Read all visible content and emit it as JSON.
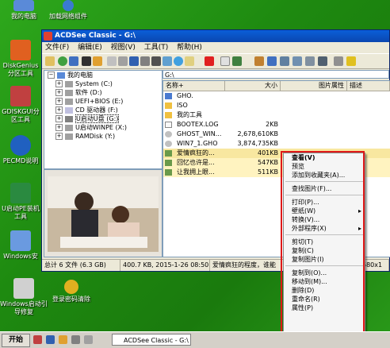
{
  "desktop": {
    "icons": [
      {
        "label": "我的电脑",
        "color": "#5a8ad8"
      },
      {
        "label": "加载网络组件",
        "color": "#3a7ad0"
      },
      {
        "label": "DiskGenius分区工具",
        "color": "#e06020"
      },
      {
        "label": "GDISKGUI分区工具",
        "color": "#c04040"
      },
      {
        "label": "PECMD说明",
        "color": "#2060c0"
      },
      {
        "label": "U启动PE装机工具",
        "color": "#2a8a40"
      },
      {
        "label": "Windows安",
        "color": "#6a9ae0"
      },
      {
        "label": "Windows启动引导修复",
        "color": "#d0d0d0"
      },
      {
        "label": "登录密码清除",
        "color": "#e0b020"
      }
    ]
  },
  "window": {
    "title": "ACDSee Classic - G:\\",
    "menus": [
      "文件(F)",
      "编辑(E)",
      "视图(V)",
      "工具(T)",
      "帮助(H)"
    ],
    "address": "G:\\",
    "tree": [
      {
        "label": "我的电脑",
        "depth": 0,
        "pm": "−"
      },
      {
        "label": "System (C:)",
        "depth": 1,
        "pm": "+"
      },
      {
        "label": "软件 (D:)",
        "depth": 1,
        "pm": "+"
      },
      {
        "label": "UEFI+BIOS (E:)",
        "depth": 1,
        "pm": "+"
      },
      {
        "label": "CD 驱动器 (F:)",
        "depth": 1,
        "pm": "+"
      },
      {
        "label": "U启动U盘 (G:)",
        "depth": 1,
        "pm": "+"
      },
      {
        "label": "U启动WINPE (X:)",
        "depth": 1,
        "pm": "+"
      },
      {
        "label": "RAMDisk (Y:)",
        "depth": 1,
        "pm": "+"
      }
    ],
    "columns": [
      "名称+",
      "大小",
      "图片属性",
      "描述"
    ],
    "rows": [
      {
        "name": "GHO.",
        "size": "",
        "type": "folder"
      },
      {
        "name": "ISO",
        "size": "",
        "type": "folder"
      },
      {
        "name": "我的工具",
        "size": "",
        "type": "folder"
      },
      {
        "name": "BOOTEX.LOG",
        "size": "2KB",
        "type": "file"
      },
      {
        "name": "GHOST_WIN...",
        "size": "2,678,610KB",
        "type": "file"
      },
      {
        "name": "WIN7_1.GHO",
        "size": "3,874,735KB",
        "type": "file"
      },
      {
        "name": "爱情疯狂的...",
        "size": "401KB",
        "type": "image",
        "sel": "act"
      },
      {
        "name": "回忆也许是...",
        "size": "547KB",
        "type": "image",
        "sel": "sel"
      },
      {
        "name": "让我拥上眼...",
        "size": "511KB",
        "type": "image",
        "sel": "sel"
      }
    ],
    "status": [
      "总计 6 文件 (6.3 GB)",
      "400.7 KB, 2015-1-26 08:50",
      "爱情疯狂的程度，谁能",
      "680x1"
    ]
  },
  "context_menu": {
    "groups": [
      [
        {
          "label": "查看(V)",
          "bold": true
        },
        {
          "label": "预览"
        },
        {
          "label": "添加到收藏夹(A)..."
        }
      ],
      [
        {
          "label": "查找图片(F)..."
        }
      ],
      [
        {
          "label": "打印(P)..."
        },
        {
          "label": "壁纸(W)",
          "sub": true
        },
        {
          "label": "转换(V)..."
        },
        {
          "label": "外部程序(X)",
          "sub": true
        }
      ],
      [
        {
          "label": "剪切(T)"
        },
        {
          "label": "复制(C)"
        },
        {
          "label": "复制图片(I)"
        }
      ],
      [
        {
          "label": "复制到(O)..."
        },
        {
          "label": "移动到(M)..."
        },
        {
          "label": "删除(D)"
        },
        {
          "label": "重命名(R)"
        },
        {
          "label": "属性(P)"
        }
      ]
    ],
    "highlight_color": "#e01818"
  },
  "taskbar": {
    "start_label": "开始",
    "task_label": "ACDSee Classic - G:\\"
  }
}
